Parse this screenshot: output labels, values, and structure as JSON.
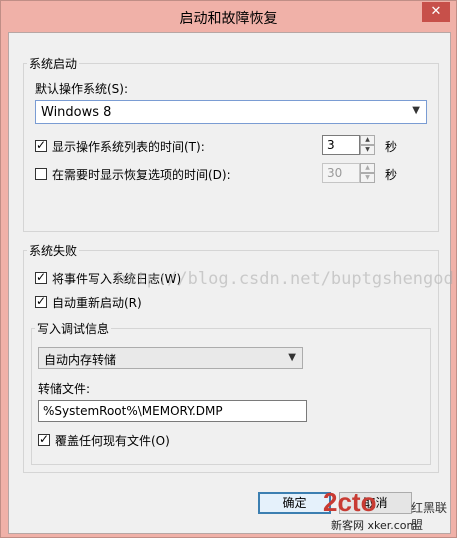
{
  "window": {
    "title": "启动和故障恢复",
    "close_symbol": "✕"
  },
  "startup": {
    "group_label": "系统启动",
    "default_os_label": "默认操作系统(S):",
    "default_os_value": "Windows 8",
    "show_os_list_label": "显示操作系统列表的时间(T):",
    "show_os_list_checked": true,
    "show_os_list_value": "3",
    "show_recovery_label": "在需要时显示恢复选项的时间(D):",
    "show_recovery_checked": false,
    "show_recovery_value": "30",
    "seconds_unit": "秒"
  },
  "failure": {
    "group_label": "系统失败",
    "write_event_label": "将事件写入系统日志(W)",
    "write_event_checked": true,
    "auto_restart_label": "自动重新启动(R)",
    "auto_restart_checked": true,
    "debug_group_label": "写入调试信息",
    "debug_type_value": "自动内存转储",
    "dump_file_label": "转储文件:",
    "dump_file_value": "%SystemRoot%\\MEMORY.DMP",
    "overwrite_label": "覆盖任何现有文件(O)",
    "overwrite_checked": true
  },
  "buttons": {
    "ok": "确定",
    "cancel": "取消"
  },
  "overlay": {
    "watermark": "http://blog.csdn.net/buptgshengod",
    "brand_big": "2cto",
    "brand_side": "红黑联盟",
    "brand_small": "新客网 xker.com"
  },
  "check_symbol": "✓",
  "icons": {
    "dropdown": "chevron-down-icon",
    "spin_up": "triangle-up-icon",
    "spin_down": "triangle-down-icon"
  }
}
